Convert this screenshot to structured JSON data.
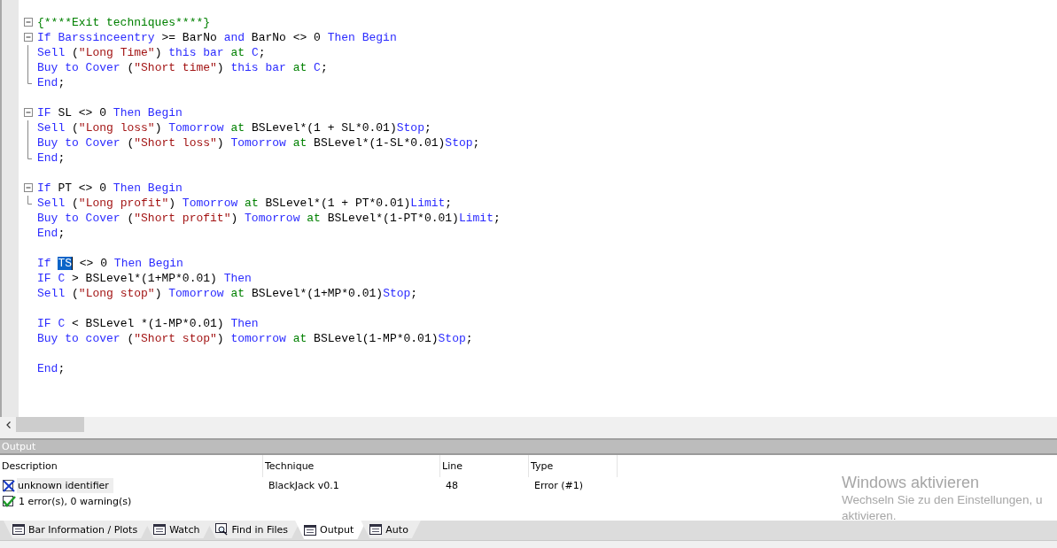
{
  "editor": {
    "lines": [
      {
        "kind": "fold-open",
        "tokens": [
          {
            "kind": "comment",
            "text": "{****Exit techniques****}"
          }
        ]
      },
      {
        "kind": "fold-open",
        "tokens": [
          {
            "kind": "keyword",
            "text": "If Barssinceentry"
          },
          {
            "kind": "plain",
            "text": " >= BarNo "
          },
          {
            "kind": "keyword",
            "text": "and"
          },
          {
            "kind": "plain",
            "text": " BarNo <> 0 "
          },
          {
            "kind": "keyword",
            "text": "Then Begin"
          }
        ]
      },
      {
        "kind": "fold-line",
        "tokens": [
          {
            "kind": "keyword",
            "text": "Sell"
          },
          {
            "kind": "plain",
            "text": " ("
          },
          {
            "kind": "string",
            "text": "\"Long Time\""
          },
          {
            "kind": "plain",
            "text": ") "
          },
          {
            "kind": "keyword",
            "text": "this bar "
          },
          {
            "kind": "reserved",
            "text": "at "
          },
          {
            "kind": "keyword",
            "text": "C"
          },
          {
            "kind": "plain",
            "text": ";"
          }
        ]
      },
      {
        "kind": "fold-line",
        "tokens": [
          {
            "kind": "keyword",
            "text": "Buy to Cover"
          },
          {
            "kind": "plain",
            "text": " ("
          },
          {
            "kind": "string",
            "text": "\"Short time\""
          },
          {
            "kind": "plain",
            "text": ") "
          },
          {
            "kind": "keyword",
            "text": "this bar "
          },
          {
            "kind": "reserved",
            "text": "at "
          },
          {
            "kind": "keyword",
            "text": "C"
          },
          {
            "kind": "plain",
            "text": ";"
          }
        ]
      },
      {
        "kind": "fold-end",
        "tokens": [
          {
            "kind": "keyword",
            "text": "End"
          },
          {
            "kind": "plain",
            "text": ";"
          }
        ]
      },
      {
        "kind": "plain"
      },
      {
        "kind": "fold-open",
        "tokens": [
          {
            "kind": "keyword",
            "text": "IF"
          },
          {
            "kind": "plain",
            "text": " SL <> 0 "
          },
          {
            "kind": "keyword",
            "text": "Then Begin"
          }
        ]
      },
      {
        "kind": "fold-line",
        "tokens": [
          {
            "kind": "keyword",
            "text": "Sell"
          },
          {
            "kind": "plain",
            "text": " ("
          },
          {
            "kind": "string",
            "text": "\"Long loss\""
          },
          {
            "kind": "plain",
            "text": ") "
          },
          {
            "kind": "keyword",
            "text": "Tomorrow "
          },
          {
            "kind": "reserved",
            "text": "at"
          },
          {
            "kind": "plain",
            "text": " BSLevel*(1 + SL*0.01)"
          },
          {
            "kind": "keyword",
            "text": "Stop"
          },
          {
            "kind": "plain",
            "text": ";"
          }
        ]
      },
      {
        "kind": "fold-line",
        "tokens": [
          {
            "kind": "keyword",
            "text": "Buy to Cover"
          },
          {
            "kind": "plain",
            "text": " ("
          },
          {
            "kind": "string",
            "text": "\"Short loss\""
          },
          {
            "kind": "plain",
            "text": ") "
          },
          {
            "kind": "keyword",
            "text": "Tomorrow "
          },
          {
            "kind": "reserved",
            "text": "at"
          },
          {
            "kind": "plain",
            "text": " BSLevel*(1-SL*0.01)"
          },
          {
            "kind": "keyword",
            "text": "Stop"
          },
          {
            "kind": "plain",
            "text": ";"
          }
        ]
      },
      {
        "kind": "fold-end",
        "tokens": [
          {
            "kind": "keyword",
            "text": "End"
          },
          {
            "kind": "plain",
            "text": ";"
          }
        ]
      },
      {
        "kind": "plain"
      },
      {
        "kind": "fold-open",
        "tokens": [
          {
            "kind": "keyword",
            "text": "If"
          },
          {
            "kind": "plain",
            "text": " PT <> 0 "
          },
          {
            "kind": "keyword",
            "text": "Then Begin"
          }
        ]
      },
      {
        "kind": "fold-end",
        "tokens": [
          {
            "kind": "keyword",
            "text": "Sell"
          },
          {
            "kind": "plain",
            "text": " ("
          },
          {
            "kind": "string",
            "text": "\"Long profit\""
          },
          {
            "kind": "plain",
            "text": ") "
          },
          {
            "kind": "keyword",
            "text": "Tomorrow "
          },
          {
            "kind": "reserved",
            "text": "at"
          },
          {
            "kind": "plain",
            "text": " BSLevel*(1 + PT*0.01)"
          },
          {
            "kind": "keyword",
            "text": "Limit"
          },
          {
            "kind": "plain",
            "text": ";"
          }
        ]
      },
      {
        "kind": "plain",
        "tokens": [
          {
            "kind": "keyword",
            "text": "Buy to Cover"
          },
          {
            "kind": "plain",
            "text": " ("
          },
          {
            "kind": "string",
            "text": "\"Short profit\""
          },
          {
            "kind": "plain",
            "text": ") "
          },
          {
            "kind": "keyword",
            "text": "Tomorrow "
          },
          {
            "kind": "reserved",
            "text": "at"
          },
          {
            "kind": "plain",
            "text": " BSLevel*(1-PT*0.01)"
          },
          {
            "kind": "keyword",
            "text": "Limit"
          },
          {
            "kind": "plain",
            "text": ";"
          }
        ]
      },
      {
        "kind": "plain",
        "tokens": [
          {
            "kind": "keyword",
            "text": "End"
          },
          {
            "kind": "plain",
            "text": ";"
          }
        ]
      },
      {
        "kind": "plain"
      },
      {
        "kind": "plain",
        "tokens": [
          {
            "kind": "keyword",
            "text": "If "
          },
          {
            "kind": "selection",
            "text": "TS"
          },
          {
            "kind": "plain",
            "text": " <> 0 "
          },
          {
            "kind": "keyword",
            "text": "Then Begin"
          }
        ]
      },
      {
        "kind": "plain",
        "tokens": [
          {
            "kind": "keyword",
            "text": "IF C"
          },
          {
            "kind": "plain",
            "text": " > BSLevel*(1+MP*0.01) "
          },
          {
            "kind": "keyword",
            "text": "Then"
          }
        ]
      },
      {
        "kind": "plain",
        "tokens": [
          {
            "kind": "keyword",
            "text": "Sell"
          },
          {
            "kind": "plain",
            "text": " ("
          },
          {
            "kind": "string",
            "text": "\"Long stop\""
          },
          {
            "kind": "plain",
            "text": ") "
          },
          {
            "kind": "keyword",
            "text": "Tomorrow "
          },
          {
            "kind": "reserved",
            "text": "at"
          },
          {
            "kind": "plain",
            "text": " BSLevel*(1+MP*0.01)"
          },
          {
            "kind": "keyword",
            "text": "Stop"
          },
          {
            "kind": "plain",
            "text": ";"
          }
        ]
      },
      {
        "kind": "plain"
      },
      {
        "kind": "plain",
        "tokens": [
          {
            "kind": "keyword",
            "text": "IF C"
          },
          {
            "kind": "plain",
            "text": " < BSLevel *(1-MP*0.01) "
          },
          {
            "kind": "keyword",
            "text": "Then"
          }
        ]
      },
      {
        "kind": "plain",
        "tokens": [
          {
            "kind": "keyword",
            "text": "Buy to cover"
          },
          {
            "kind": "plain",
            "text": " ("
          },
          {
            "kind": "string",
            "text": "\"Short stop\""
          },
          {
            "kind": "plain",
            "text": ") "
          },
          {
            "kind": "keyword",
            "text": "tomorrow "
          },
          {
            "kind": "reserved",
            "text": "at"
          },
          {
            "kind": "plain",
            "text": " BSLevel(1-MP*0.01)"
          },
          {
            "kind": "keyword",
            "text": "Stop"
          },
          {
            "kind": "plain",
            "text": ";"
          }
        ]
      },
      {
        "kind": "plain"
      },
      {
        "kind": "plain",
        "tokens": [
          {
            "kind": "keyword",
            "text": "End"
          },
          {
            "kind": "plain",
            "text": ";"
          }
        ]
      }
    ]
  },
  "output": {
    "title": "Output",
    "columns": [
      "Description",
      "Technique",
      "Line",
      "Type"
    ],
    "rows": [
      {
        "kind": "error",
        "selected": true,
        "cells": [
          "unknown identifier",
          "BlackJack v0.1",
          "48",
          "Error (#1)"
        ]
      }
    ],
    "summary": {
      "kind": "done",
      "text": "1 error(s), 0 warning(s)"
    }
  },
  "tabs": [
    {
      "label": "Bar Information / Plots",
      "kind": "list",
      "selected": false
    },
    {
      "label": "Watch",
      "kind": "list",
      "selected": false
    },
    {
      "label": "Find in Files",
      "kind": "find",
      "selected": false
    },
    {
      "label": "Output",
      "kind": "list",
      "selected": true
    },
    {
      "label": "Auto",
      "kind": "list",
      "selected": false
    }
  ],
  "activation_notice": {
    "title": "Windows aktivieren",
    "lines": [
      "Wechseln Sie zu den Einstellungen, u",
      "aktivieren."
    ]
  }
}
